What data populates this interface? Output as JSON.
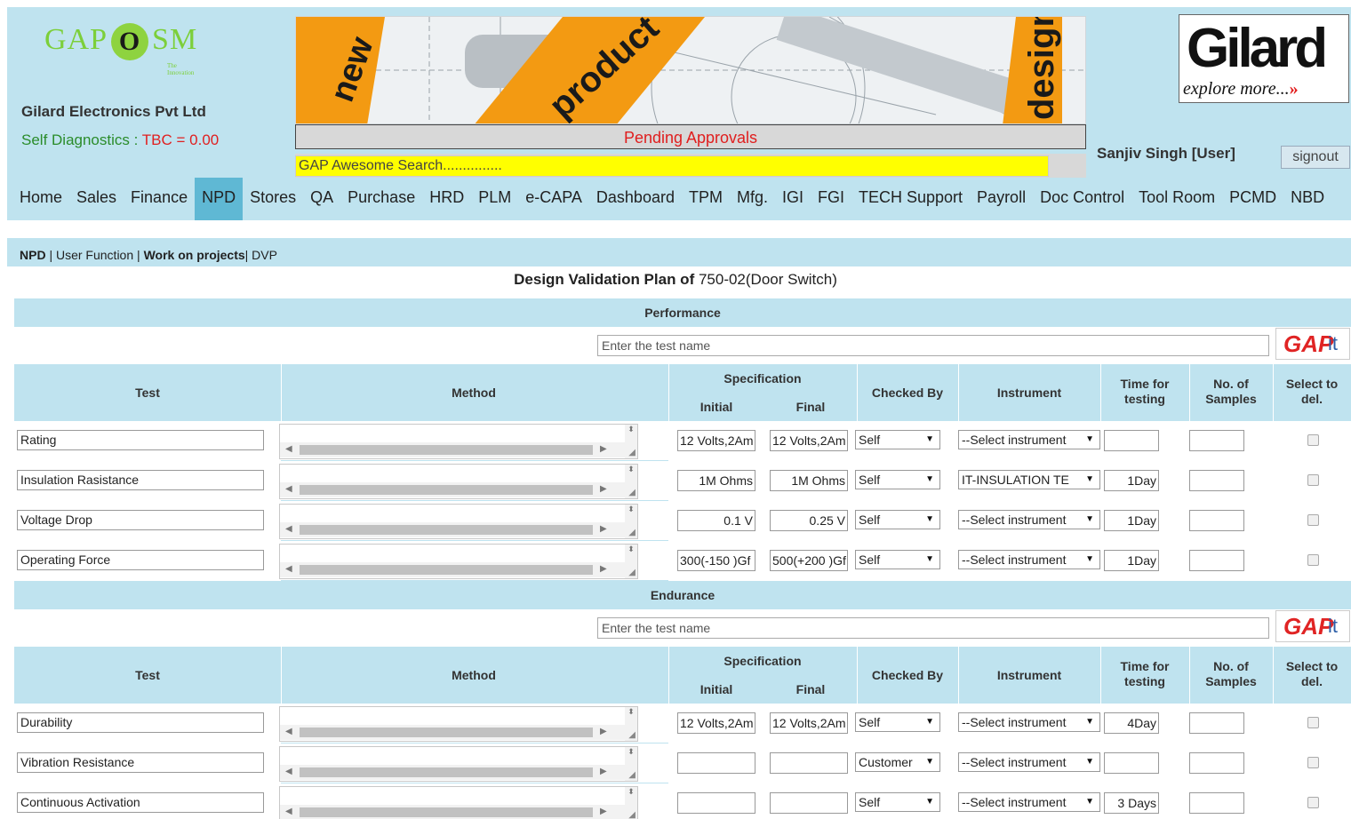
{
  "header": {
    "logo": {
      "pre": "GAP",
      "o": "O",
      "post": "SM",
      "tag": "The Innovation"
    },
    "company": "Gilard Electronics Pvt Ltd",
    "self_diag_label": "Self Diagnostics : ",
    "tbc": "TBC = 0.00",
    "banner_words": [
      "new",
      "product",
      "design"
    ],
    "pending": "Pending Approvals",
    "search_placeholder": "GAP Awesome Search...............",
    "brand": {
      "name": "Gilard",
      "tagline": "explore more...",
      "arrow": "»"
    },
    "user": "Sanjiv Singh [User]",
    "signout": "signout"
  },
  "nav": {
    "items": [
      "Home",
      "Sales",
      "Finance",
      "NPD",
      "Stores",
      "QA",
      "Purchase",
      "HRD",
      "PLM",
      "e-CAPA",
      "Dashboard",
      "TPM",
      "Mfg.",
      "IGI",
      "FGI",
      "TECH Support",
      "Payroll",
      "Doc Control",
      "Tool Room",
      "PCMD",
      "NBD"
    ],
    "active": "NPD"
  },
  "breadcrumb": {
    "a": "NPD",
    "sep": " | ",
    "b": "User Function",
    "c": "Work on projects",
    "d": "| DVP"
  },
  "title": {
    "bold": "Design Validation Plan of",
    "rest": " 750-02(Door Switch)"
  },
  "add_placeholder": "Enter the test name",
  "gapit": {
    "g": "GAP",
    "it": "it"
  },
  "columns": {
    "test": "Test",
    "method": "Method",
    "specification": "Specification",
    "initial": "Initial",
    "final": "Final",
    "checked_by": "Checked By",
    "instrument": "Instrument",
    "time": "Time for testing",
    "samples": "No. of Samples",
    "select": "Select to del."
  },
  "sections": [
    {
      "name": "Performance",
      "rows": [
        {
          "test": "Rating",
          "initial": "12 Volts,2Am",
          "final": "12 Volts,2Am",
          "checked": "Self",
          "instrument": "--Select instrument",
          "time": "",
          "samples": ""
        },
        {
          "test": "Insulation Rasistance",
          "initial": "1M Ohms",
          "final": "1M Ohms",
          "checked": "Self",
          "instrument": "IT-INSULATION TE",
          "time": "1Day",
          "samples": ""
        },
        {
          "test": "Voltage Drop",
          "initial": "0.1 V",
          "final": "0.25 V",
          "checked": "Self",
          "instrument": "--Select instrument",
          "time": "1Day",
          "samples": ""
        },
        {
          "test": "Operating Force",
          "initial": "300(-150 )Gf",
          "final": "500(+200 )Gf",
          "checked": "Self",
          "instrument": "--Select instrument",
          "time": "1Day",
          "samples": ""
        }
      ]
    },
    {
      "name": "Endurance",
      "rows": [
        {
          "test": "Durability",
          "initial": "12 Volts,2Am",
          "final": "12 Volts,2Am",
          "checked": "Self",
          "instrument": "--Select instrument",
          "time": "4Day",
          "samples": ""
        },
        {
          "test": "Vibration Resistance",
          "initial": "",
          "final": "",
          "checked": "Customer",
          "instrument": "--Select instrument",
          "time": "",
          "samples": ""
        },
        {
          "test": "Continuous Activation",
          "initial": "",
          "final": "",
          "checked": "Self",
          "instrument": "--Select instrument",
          "time": "3 Days",
          "samples": ""
        }
      ]
    }
  ]
}
